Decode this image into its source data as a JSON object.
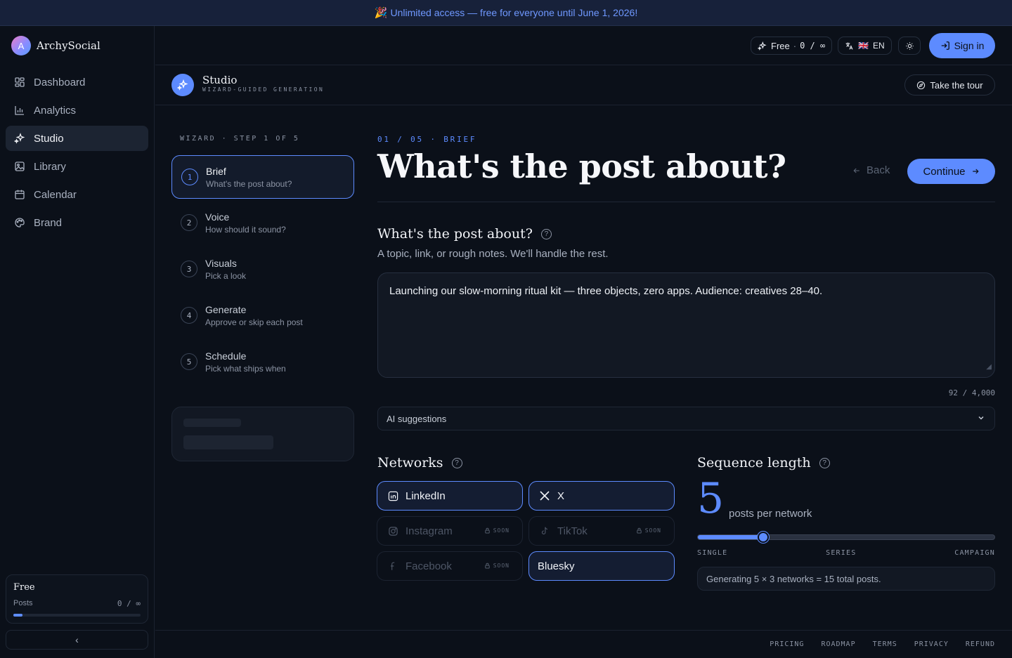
{
  "banner": {
    "emoji": "🎉",
    "text": "Unlimited access — free for everyone until June 1, 2026!"
  },
  "app": {
    "avatar_letter": "A",
    "name": "ArchySocial"
  },
  "sidebar": {
    "items": [
      {
        "label": "Dashboard",
        "icon": "dashboard-icon"
      },
      {
        "label": "Analytics",
        "icon": "bar-chart-icon"
      },
      {
        "label": "Studio",
        "icon": "sparkles-icon",
        "active": true
      },
      {
        "label": "Library",
        "icon": "image-icon"
      },
      {
        "label": "Calendar",
        "icon": "calendar-icon"
      },
      {
        "label": "Brand",
        "icon": "palette-icon"
      }
    ],
    "plan": {
      "title": "Free",
      "label": "Posts",
      "usage": "0 / ∞",
      "progress_fraction": 0.07
    },
    "collapse_glyph": "‹"
  },
  "topbar": {
    "plan_pill": {
      "name": "Free",
      "sep": "·",
      "usage": "0 / ∞"
    },
    "lang_pill": {
      "flag": "🇬🇧",
      "code": "EN"
    },
    "sign_in": "Sign in"
  },
  "studio": {
    "title": "Studio",
    "subtitle": "WIZARD-GUIDED GENERATION",
    "tour": "Take the tour"
  },
  "wizard": {
    "label": "WIZARD · STEP 1 OF 5",
    "steps": [
      {
        "num": "1",
        "title": "Brief",
        "desc": "What's the post about?"
      },
      {
        "num": "2",
        "title": "Voice",
        "desc": "How should it sound?"
      },
      {
        "num": "3",
        "title": "Visuals",
        "desc": "Pick a look"
      },
      {
        "num": "4",
        "title": "Generate",
        "desc": "Approve or skip each post"
      },
      {
        "num": "5",
        "title": "Schedule",
        "desc": "Pick what ships when"
      }
    ]
  },
  "main": {
    "crumb": "01 / 05 · BRIEF",
    "heading": "What's the post about?",
    "back": "Back",
    "continue": "Continue",
    "question": "What's the post about?",
    "question_desc": "A topic, link, or rough notes. We'll handle the rest.",
    "brief_text": "Launching our slow-morning ritual kit — three objects, zero apps. Audience: creatives 28–40.",
    "counter": "92 / 4,000",
    "ai_suggestions": "AI suggestions"
  },
  "networks": {
    "title": "Networks",
    "soon_label": "SOON",
    "items": [
      {
        "name": "LinkedIn",
        "icon": "linkedin-icon",
        "selected": true
      },
      {
        "name": "X",
        "icon": "x-icon",
        "selected": true
      },
      {
        "name": "Instagram",
        "icon": "instagram-icon",
        "soon": true
      },
      {
        "name": "TikTok",
        "icon": "tiktok-icon",
        "soon": true
      },
      {
        "name": "Facebook",
        "icon": "facebook-icon",
        "soon": true
      },
      {
        "name": "Bluesky",
        "icon": "",
        "selected": true
      }
    ]
  },
  "sequence": {
    "title": "Sequence length",
    "value": "5",
    "unit": "posts per network",
    "slider_fraction": 0.22,
    "labels": [
      "SINGLE",
      "SERIES",
      "CAMPAIGN"
    ],
    "summary": "Generating 5 × 3 networks = 15 total posts."
  },
  "footer": {
    "links": [
      "PRICING",
      "ROADMAP",
      "TERMS",
      "PRIVACY",
      "REFUND"
    ]
  },
  "colors": {
    "accent": "#5d8bff",
    "background": "#0b1019",
    "banner_bg": "#17213a"
  }
}
